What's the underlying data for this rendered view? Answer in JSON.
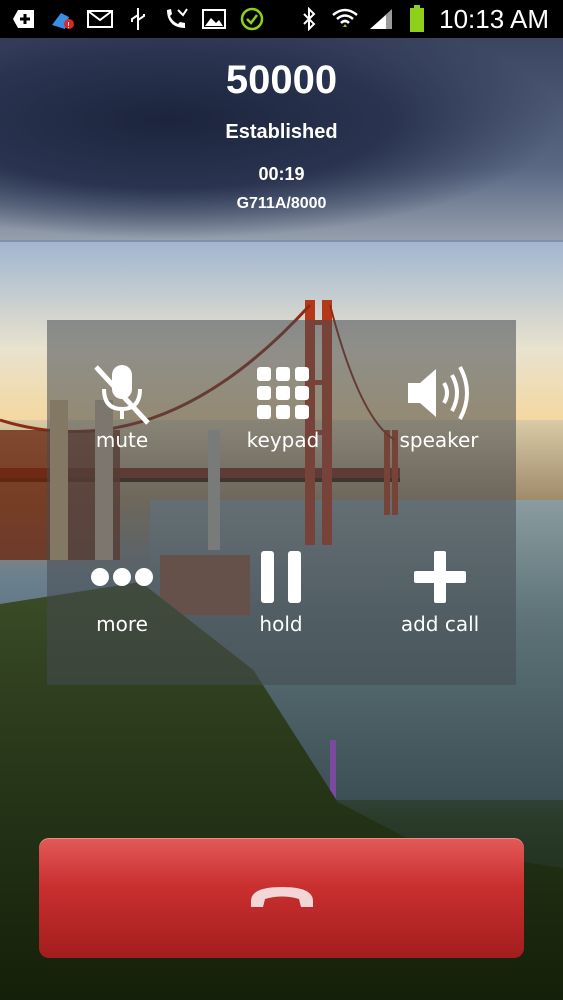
{
  "status_bar": {
    "icons": [
      "add-notification-icon",
      "cleanup-icon",
      "mail-icon",
      "usb-icon",
      "missed-call-icon",
      "image-icon",
      "check-icon",
      "bluetooth-icon",
      "wifi-icon",
      "signal-icon",
      "battery-icon"
    ],
    "time": "10:13 AM"
  },
  "call": {
    "number": "50000",
    "state": "Established",
    "duration": "00:19",
    "codec": "G711A/8000"
  },
  "controls": [
    {
      "label": "mute",
      "icon": "mic-muted-icon"
    },
    {
      "label": "keypad",
      "icon": "keypad-icon"
    },
    {
      "label": "speaker",
      "icon": "speaker-icon"
    },
    {
      "label": "more",
      "icon": "more-icon"
    },
    {
      "label": "hold",
      "icon": "pause-icon"
    },
    {
      "label": "add call",
      "icon": "plus-icon"
    }
  ],
  "end_call": {
    "icon": "hang-up-icon",
    "color": "#c9302f"
  }
}
